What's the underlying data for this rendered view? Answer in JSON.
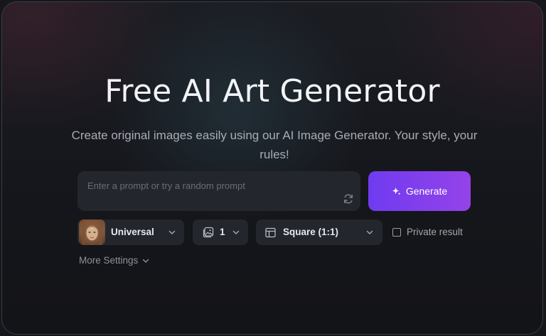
{
  "hero": {
    "title": "Free AI Art Generator",
    "subtitle": "Create original images easily using our AI Image Generator. Your style, your rules!"
  },
  "prompt": {
    "placeholder": "Enter a prompt or try a random prompt",
    "value": "",
    "refresh_icon": "refresh-icon"
  },
  "generate": {
    "label": "Generate",
    "icon": "sparkle-icon",
    "gradient_start": "#6f3bf0",
    "gradient_end": "#9443e8"
  },
  "options": {
    "model": {
      "label": "Universal",
      "icon": "model-avatar"
    },
    "count": {
      "label": "1",
      "icon": "image-icon"
    },
    "aspect_ratio": {
      "label": "Square (1:1)",
      "icon": "layout-icon"
    },
    "private": {
      "label": "Private result",
      "checked": false
    }
  },
  "more_settings": {
    "label": "More Settings",
    "icon": "chevron-down-icon"
  },
  "colors": {
    "background": "#16171c",
    "panel": "#24262d",
    "text": "#f3f4f7",
    "muted_text": "#a9acb5"
  }
}
